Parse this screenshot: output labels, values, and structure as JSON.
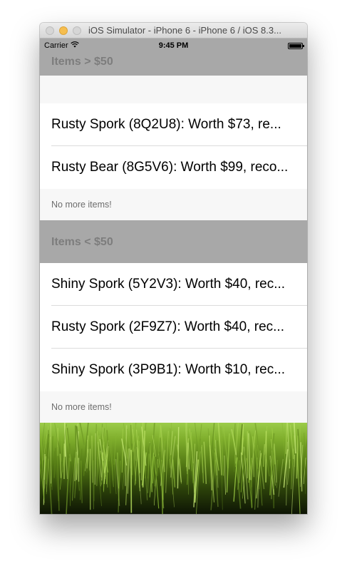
{
  "window": {
    "title": "iOS Simulator - iPhone 6 - iPhone 6 / iOS 8.3..."
  },
  "statusbar": {
    "carrier": "Carrier",
    "time": "9:45 PM"
  },
  "sections": [
    {
      "header": "Items > $50",
      "rows": [
        "Rusty Spork (8Q2U8): Worth $73, re...",
        "Rusty Bear (8G5V6): Worth $99, reco..."
      ],
      "footer": "No more items!"
    },
    {
      "header": "Items < $50",
      "rows": [
        "Shiny Spork (5Y2V3): Worth $40, rec...",
        "Rusty Spork (2F9Z7): Worth $40, rec...",
        "Shiny Spork (3P9B1): Worth $10, rec..."
      ],
      "footer": "No more items!"
    }
  ],
  "icons": {
    "wifi": "wifi-icon",
    "battery": "battery-icon",
    "background": "grass-background-image"
  },
  "colors": {
    "section_header_bg": "#a8a8a8",
    "section_header_text": "#7d7d7d",
    "footer_text": "#6d6d6d",
    "traffic_minimize": "#f6be4f"
  }
}
